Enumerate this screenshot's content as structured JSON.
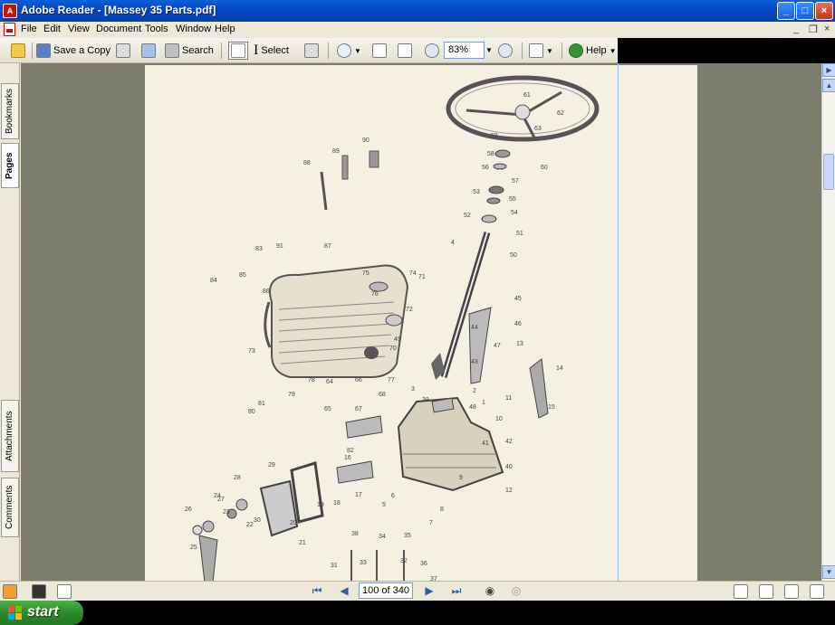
{
  "window": {
    "title": "Adobe Reader - [Massey 35 Parts.pdf]",
    "app_icon": "pdf-icon"
  },
  "window_controls": {
    "minimize": "_",
    "maximize": "□",
    "close": "×"
  },
  "menu": [
    "File",
    "Edit",
    "View",
    "Document",
    "Tools",
    "Window",
    "Help"
  ],
  "mdi_controls": {
    "minimize": "_",
    "restore": "❐",
    "close": "×"
  },
  "toolbar": {
    "save_copy": "Save a Copy",
    "search": "Search",
    "select": "Select",
    "zoom_value": "83%",
    "help": "Help"
  },
  "side_tabs": {
    "bookmarks": "Bookmarks",
    "pages": "Pages",
    "attachments": "Attachments",
    "comments": "Comments"
  },
  "diagram_labels": [
    "61",
    "62",
    "63",
    "59",
    "58",
    "57",
    "56",
    "55",
    "54",
    "53",
    "52",
    "51",
    "50",
    "4",
    "60",
    "89",
    "90",
    "88",
    "87",
    "83",
    "91",
    "84",
    "85",
    "86",
    "74",
    "75",
    "76",
    "77",
    "78",
    "79",
    "80",
    "81",
    "64",
    "65",
    "66",
    "67",
    "68",
    "45",
    "46",
    "47",
    "44",
    "43",
    "42",
    "41",
    "40",
    "12",
    "13",
    "14",
    "15",
    "11",
    "10",
    "9",
    "8",
    "7",
    "6",
    "5",
    "3",
    "2",
    "1",
    "16",
    "17",
    "18",
    "19",
    "20",
    "21",
    "22",
    "23",
    "24",
    "25",
    "26",
    "27",
    "28",
    "29",
    "30",
    "31",
    "32",
    "33",
    "34",
    "35",
    "36",
    "37",
    "38",
    "39",
    "48",
    "49",
    "70",
    "71",
    "72",
    "73",
    "82"
  ],
  "status": {
    "page_field": "100 of 340"
  },
  "taskbar": {
    "start_label": "start"
  },
  "colors": {
    "title_bar": "#0a5fd8",
    "doc_background": "#7d7d6d",
    "page": "#f5f1e2",
    "start_button": "#2b8a2b"
  }
}
